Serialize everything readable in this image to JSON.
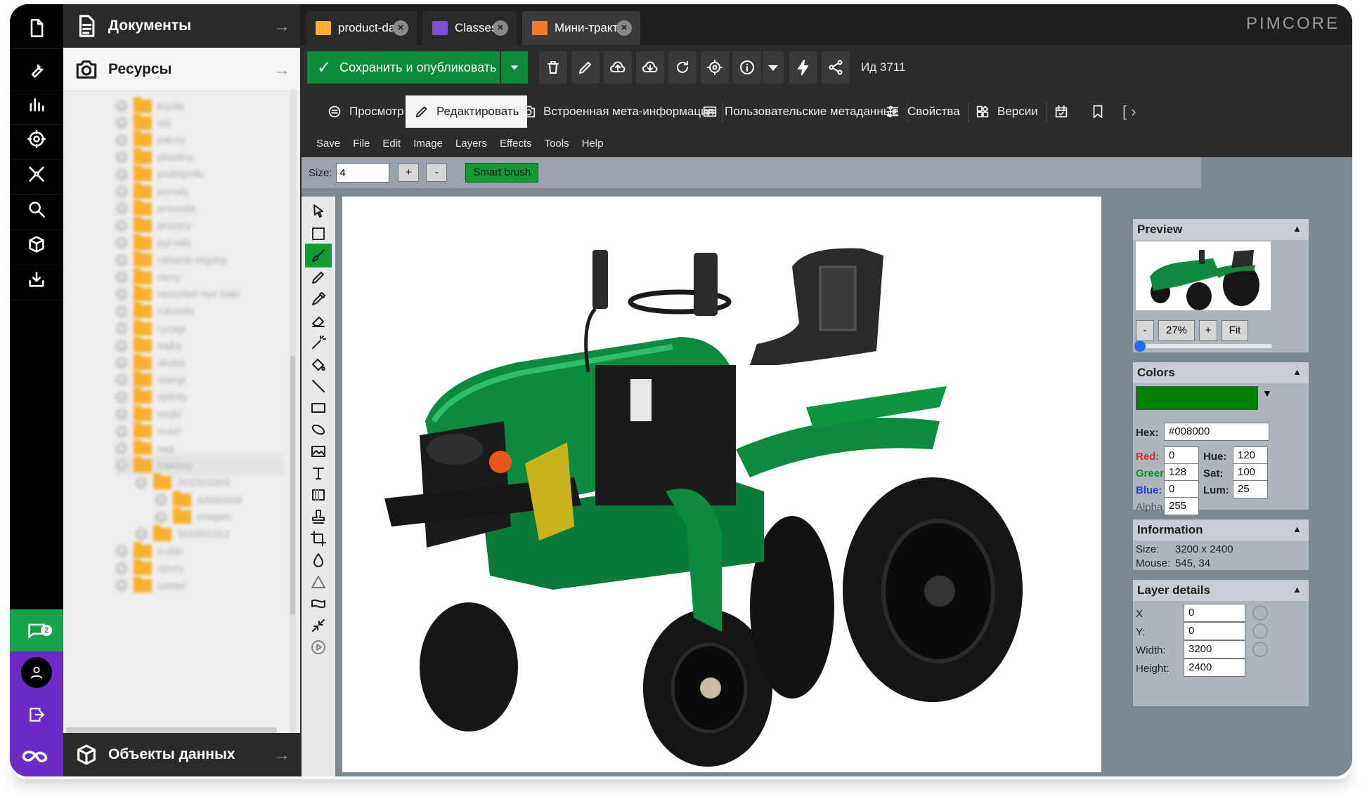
{
  "app": {
    "logo": "PIMCORE",
    "accent_color": "#0c8a3a"
  },
  "rail": {
    "icons": [
      "document-icon",
      "wrench-icon",
      "bar-chart-icon",
      "gear-icon",
      "network-icon",
      "search-icon",
      "cube-icon",
      "inbox-icon"
    ],
    "chat_badge": "2"
  },
  "tree": {
    "documents_label": "Документы",
    "assets_label": "Ресурсы",
    "objects_label": "Объекты данных",
    "items": [
      "kryski",
      "osi",
      "pal-cy",
      "plastiny",
      "podsipniki",
      "portaly",
      "provoda",
      "pruziny",
      "pyl-niki",
      "rabocie organy",
      "ramy",
      "rassiritel-nye baki",
      "rukoatki",
      "rycagi",
      "sajby",
      "skoba",
      "stangi",
      "splinty",
      "stojki",
      "svazi",
      "tagi",
      "traktory",
      "301001004",
      "additional",
      "images",
      "301001012",
      "trubki",
      "upory",
      "ustitel"
    ]
  },
  "tabs": [
    {
      "label": "product-data",
      "icon": "folder-icon"
    },
    {
      "label": "Classes",
      "icon": "classes-icon"
    },
    {
      "label": "Мини-трактор",
      "icon": "image-icon"
    }
  ],
  "toolbar": {
    "save_label": "Сохранить и опубликовать",
    "id_label": "Ид 3711"
  },
  "subtabs": {
    "preview": "Просмотр",
    "edit": "Редактировать",
    "embedded_meta": "Встроенная мета-информация",
    "custom_meta": "Пользовательские метаданные",
    "properties": "Свойства",
    "versions": "Версии"
  },
  "editor_menu": [
    "Save",
    "File",
    "Edit",
    "Image",
    "Layers",
    "Effects",
    "Tools",
    "Help"
  ],
  "options": {
    "size_label": "Size:",
    "size_value": "4",
    "plus": "+",
    "minus": "-",
    "smart_brush": "Smart brush"
  },
  "preview": {
    "title": "Preview",
    "zoom_minus": "-",
    "zoom_value": "27%",
    "zoom_plus": "+",
    "fit": "Fit"
  },
  "colors": {
    "title": "Colors",
    "swatch": "#008000",
    "hex_label": "Hex:",
    "hex_value": "#008000",
    "red_label": "Red:",
    "red_value": "0",
    "green_label": "Green:",
    "green_value": "128",
    "blue_label": "Blue:",
    "blue_value": "0",
    "alpha_label": "Alpha:",
    "alpha_value": "255",
    "hue_label": "Hue:",
    "hue_value": "120",
    "sat_label": "Sat:",
    "sat_value": "100",
    "lum_label": "Lum:",
    "lum_value": "25"
  },
  "information": {
    "title": "Information",
    "size_label": "Size:",
    "size_value": "3200 x 2400",
    "mouse_label": "Mouse:",
    "mouse_value": "545, 34"
  },
  "layer": {
    "title": "Layer details",
    "x_label": "X",
    "x_value": "0",
    "y_label": "Y:",
    "y_value": "0",
    "width_label": "Width:",
    "width_value": "3200",
    "height_label": "Height:",
    "height_value": "2400"
  }
}
